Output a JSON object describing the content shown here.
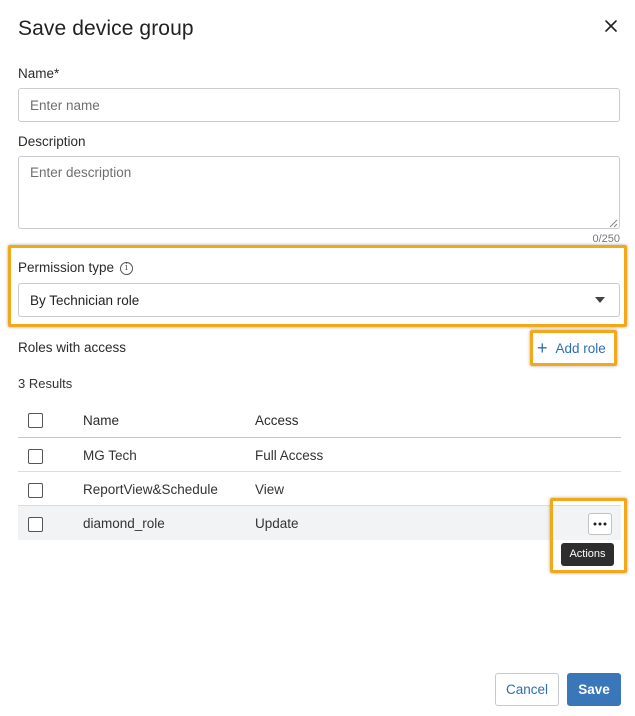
{
  "dialog": {
    "title": "Save device group"
  },
  "form": {
    "name_label": "Name*",
    "name_placeholder": "Enter name",
    "description_label": "Description",
    "description_placeholder": "Enter description",
    "description_counter": "0/250",
    "permission_type_label": "Permission type",
    "permission_type_info_icon": "info-icon",
    "permission_type_value": "By Technician role"
  },
  "roles": {
    "section_label": "Roles with access",
    "add_role_label": "Add role",
    "results_count": "3 Results",
    "columns": [
      "Name",
      "Access"
    ],
    "rows": [
      {
        "name": "MG Tech",
        "access": "Full Access"
      },
      {
        "name": "ReportView&Schedule",
        "access": "View"
      },
      {
        "name": "diamond_role",
        "access": "Update"
      }
    ],
    "actions_tooltip": "Actions",
    "actions_icon": "ellipsis-icon"
  },
  "footer": {
    "cancel_label": "Cancel",
    "save_label": "Save"
  },
  "colors": {
    "accent": "#3a77b8",
    "link": "#2e6fb2",
    "highlight": "#f2a818",
    "tooltip_bg": "#2e2e2e"
  }
}
